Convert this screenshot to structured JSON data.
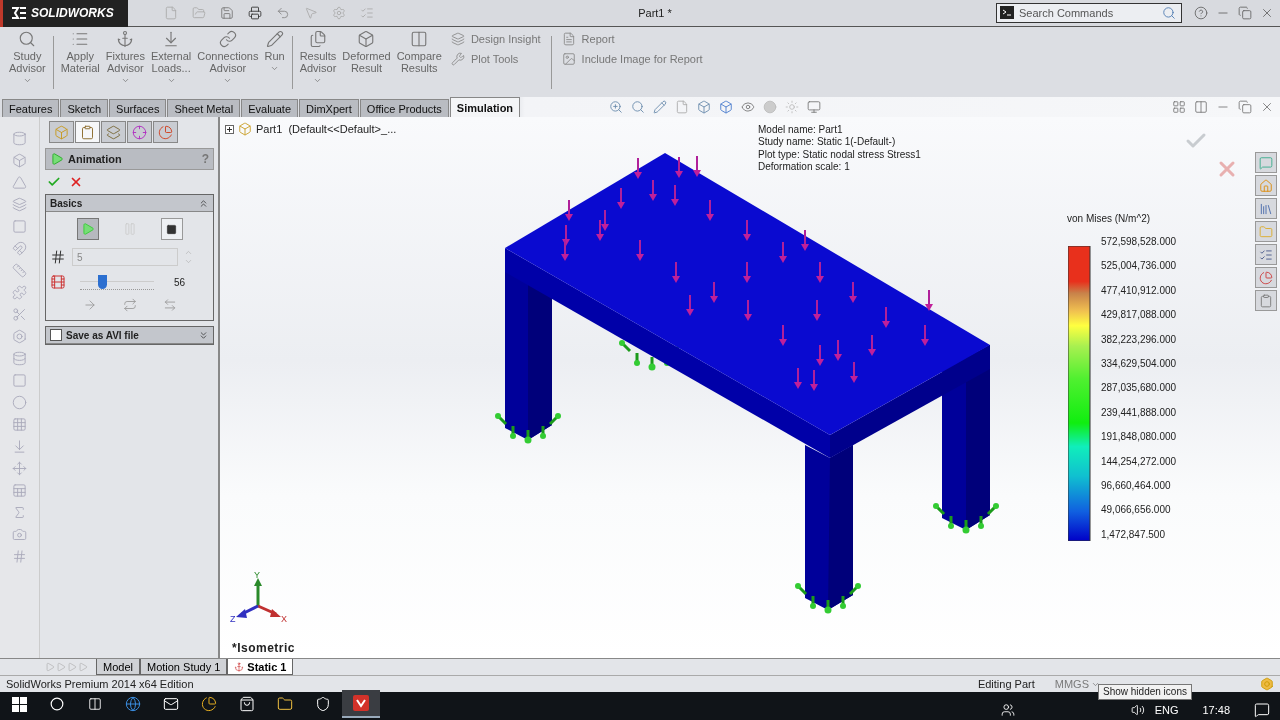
{
  "app": {
    "logo_text": "SOLIDWORKS",
    "title": "Part1 *"
  },
  "search": {
    "placeholder": "Search Commands"
  },
  "ribbon": {
    "large": [
      {
        "kind": "study",
        "label": "Study\nAdvisor",
        "dropdown": true
      },
      {
        "kind": "material",
        "label": "Apply\nMaterial",
        "dropdown": false
      },
      {
        "kind": "fixtures",
        "label": "Fixtures\nAdvisor",
        "dropdown": true
      },
      {
        "kind": "loads",
        "label": "External\nLoads...",
        "dropdown": true
      },
      {
        "kind": "connections",
        "label": "Connections\nAdvisor",
        "dropdown": true
      },
      {
        "kind": "run",
        "label": "Run",
        "dropdown": true
      },
      {
        "kind": "results",
        "label": "Results\nAdvisor",
        "dropdown": true
      },
      {
        "kind": "deformed",
        "label": "Deformed\nResult",
        "dropdown": false
      },
      {
        "kind": "compare",
        "label": "Compare\nResults",
        "dropdown": false
      }
    ],
    "small": [
      {
        "kind": "insight",
        "label": "Design Insight"
      },
      {
        "kind": "plot",
        "label": "Plot Tools"
      },
      {
        "kind": "report",
        "label": "Report"
      },
      {
        "kind": "image",
        "label": "Include Image for Report"
      }
    ]
  },
  "tabs": [
    {
      "label": "Features",
      "selected": false
    },
    {
      "label": "Sketch",
      "selected": false
    },
    {
      "label": "Surfaces",
      "selected": false
    },
    {
      "label": "Sheet Metal",
      "selected": false
    },
    {
      "label": "Evaluate",
      "selected": false
    },
    {
      "label": "DimXpert",
      "selected": false
    },
    {
      "label": "Office Products",
      "selected": false
    },
    {
      "label": "Simulation",
      "selected": true
    }
  ],
  "panel": {
    "tabs": [
      {
        "kind": "tree",
        "selected": false
      },
      {
        "kind": "property",
        "selected": true
      },
      {
        "kind": "config",
        "selected": false
      },
      {
        "kind": "dim",
        "selected": false
      },
      {
        "kind": "display",
        "selected": false
      }
    ],
    "title": "Animation",
    "help": "?",
    "basics": {
      "title": "Basics",
      "expanded": true,
      "buttons": [
        {
          "kind": "play",
          "selected": true,
          "disabled": false
        },
        {
          "kind": "pause",
          "selected": false,
          "disabled": true
        },
        {
          "kind": "stop",
          "selected": false,
          "disabled": false
        }
      ],
      "frames": {
        "value": "5",
        "disabled": true
      },
      "speed": {
        "level": 0.3,
        "reading": "56"
      }
    },
    "save_avi": {
      "label": "Save as AVI file",
      "checked": false,
      "expanded": false
    }
  },
  "viewport": {
    "tree_item": {
      "label": "Part1  (Default<<Default>_...",
      "expanded": false
    },
    "info": [
      "Model name: Part1",
      "Study name: Static 1(-Default-)",
      "Plot type: Static nodal stress Stress1",
      "Deformation scale: 1"
    ],
    "legend": {
      "title": "von Mises (N/m^2)",
      "labels": [
        "572,598,528.000",
        "525,004,736.000",
        "477,410,912.000",
        "429,817,088.000",
        "382,223,296.000",
        "334,629,504.000",
        "287,035,680.000",
        "239,441,888.000",
        "191,848,080.000",
        "144,254,272.000",
        "96,660,464.000",
        "49,066,656.000",
        "1,472,847.500"
      ]
    },
    "axes": {
      "x": "X",
      "y": "Y",
      "z": "Z"
    },
    "view_name": "*Isometric"
  },
  "bottom_tabs": [
    {
      "label": "Model",
      "selected": false
    },
    {
      "label": "Motion Study 1",
      "selected": false
    },
    {
      "label": "Static 1",
      "selected": true
    }
  ],
  "status": {
    "edition": "SolidWorks Premium 2014 x64 Edition",
    "mode": "Editing Part",
    "units": "MMGS"
  },
  "tooltip": "Show hidden icons",
  "taskbar": {
    "language": "ENG",
    "time": "17:48"
  }
}
